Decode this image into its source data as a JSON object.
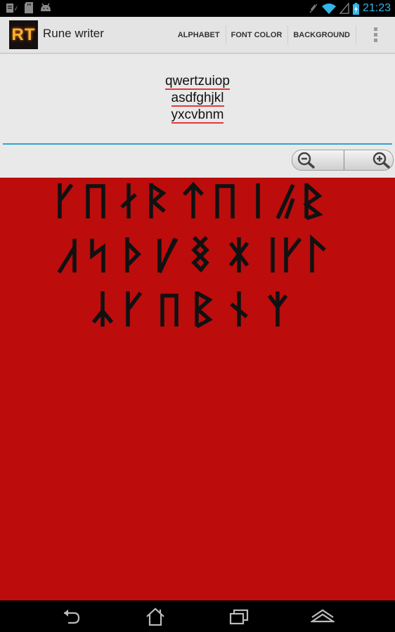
{
  "status_bar": {
    "time": "21:23",
    "left_icons": [
      "notes-icon",
      "sd-card-icon",
      "android-icon"
    ],
    "right_icons": [
      "mute-icon",
      "wifi-icon",
      "signal-icon",
      "battery-charging-icon"
    ]
  },
  "action_bar": {
    "app_icon_text": "RT",
    "title": "Rune writer",
    "actions": [
      "ALPHABET",
      "FONT COLOR",
      "BACKGROUND"
    ],
    "overflow": "more-options-icon"
  },
  "input": {
    "lines": [
      "qwertzuiop",
      "asdfghjkl",
      "yxcvbnm"
    ]
  },
  "zoom_controls": {
    "zoom_out": "zoom-out-icon",
    "zoom_in": "zoom-in-icon"
  },
  "canvas": {
    "background_color": "#bc0c0c",
    "font_color": "#111111",
    "rows": [
      [
        "q",
        "w",
        "e",
        "r",
        "t",
        "z",
        "u",
        "i",
        "o",
        "p"
      ],
      [
        "a",
        "s",
        "d",
        "f",
        "g",
        "h",
        "j",
        "k",
        "l"
      ],
      [
        "y",
        "x",
        "c",
        "v",
        "b",
        "n",
        "m"
      ]
    ]
  },
  "nav_bar": {
    "buttons": [
      "back",
      "home",
      "recent-apps",
      "menu-up"
    ]
  }
}
